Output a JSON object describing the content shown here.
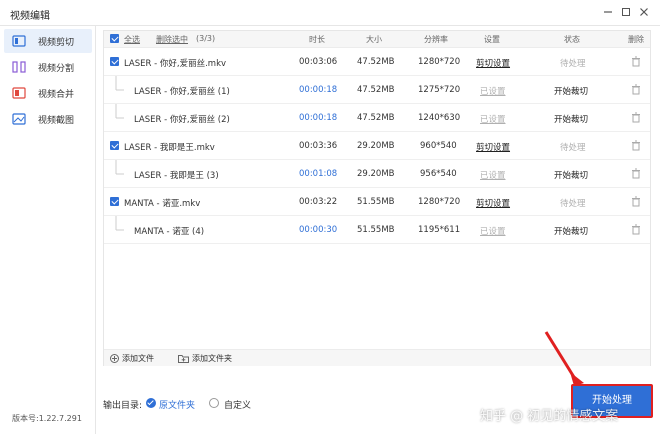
{
  "window": {
    "title": "视频编辑"
  },
  "sidebar": {
    "items": [
      {
        "label": "视频剪切",
        "icon": "scissors-video-icon",
        "active": true
      },
      {
        "label": "视频分割",
        "icon": "split-icon",
        "active": false
      },
      {
        "label": "视频合并",
        "icon": "merge-icon",
        "active": false
      },
      {
        "label": "视频截图",
        "icon": "screenshot-icon",
        "active": false
      }
    ],
    "version": "版本号:1.22.7.291"
  },
  "table": {
    "select_all": "全选",
    "delete_selected": "删除选中",
    "count": "(3/3)",
    "columns": {
      "duration": "时长",
      "size": "大小",
      "resolution": "分辨率",
      "settings": "设置",
      "status": "状态",
      "delete": "删除"
    },
    "rows": [
      {
        "type": "file",
        "name": "LASER - 你好,爱丽丝.mkv",
        "duration": "00:03:06",
        "size": "47.52MB",
        "resolution": "1280*720",
        "setting": "剪切设置",
        "status": "待处理"
      },
      {
        "type": "clip",
        "name": "LASER - 你好,爱丽丝 (1)",
        "duration": "00:00:18",
        "size": "47.52MB",
        "resolution": "1275*720",
        "setting": "已设置",
        "status": "开始裁切"
      },
      {
        "type": "clip",
        "name": "LASER - 你好,爱丽丝 (2)",
        "duration": "00:00:18",
        "size": "47.52MB",
        "resolution": "1240*630",
        "setting": "已设置",
        "status": "开始裁切"
      },
      {
        "type": "file",
        "name": "LASER - 我即是王.mkv",
        "duration": "00:03:36",
        "size": "29.20MB",
        "resolution": "960*540",
        "setting": "剪切设置",
        "status": "待处理"
      },
      {
        "type": "clip",
        "name": "LASER - 我即是王 (3)",
        "duration": "00:01:08",
        "size": "29.20MB",
        "resolution": "956*540",
        "setting": "已设置",
        "status": "开始裁切"
      },
      {
        "type": "file",
        "name": "MANTA - 诺亚.mkv",
        "duration": "00:03:22",
        "size": "51.55MB",
        "resolution": "1280*720",
        "setting": "剪切设置",
        "status": "待处理"
      },
      {
        "type": "clip",
        "name": "MANTA - 诺亚 (4)",
        "duration": "00:00:30",
        "size": "51.55MB",
        "resolution": "1195*611",
        "setting": "已设置",
        "status": "开始裁切"
      }
    ],
    "add_file": "添加文件",
    "add_folder": "添加文件夹"
  },
  "output": {
    "label": "输出目录:",
    "options": [
      {
        "label": "原文件夹",
        "selected": true
      },
      {
        "label": "自定义",
        "selected": false
      }
    ]
  },
  "start_button": "开始处理",
  "watermark": "知乎 @ 初见的情感文案",
  "colors": {
    "accent": "#2f6fd6",
    "highlight_border": "#e02020",
    "muted": "#b0b0b0"
  }
}
